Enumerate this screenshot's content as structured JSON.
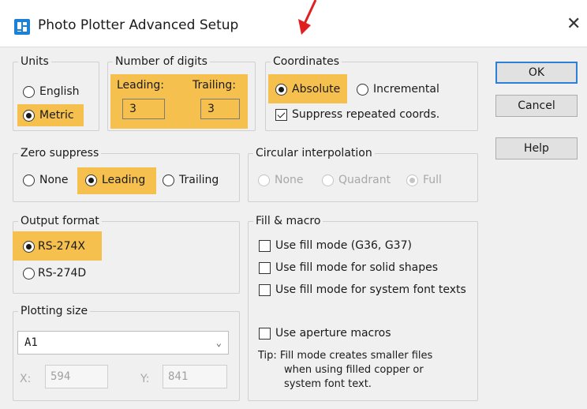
{
  "window": {
    "title": "Photo Plotter Advanced Setup",
    "close_symbol": "✕"
  },
  "colors": {
    "highlight": "#f5c04e",
    "accent_blue": "#1e7fd6",
    "annotation_arrow": "#e02020"
  },
  "units": {
    "legend": "Units",
    "options": [
      "English",
      "Metric"
    ],
    "selected": "Metric"
  },
  "digits": {
    "legend": "Number of digits",
    "leading_label": "Leading:",
    "trailing_label": "Trailing:",
    "leading_value": "3",
    "trailing_value": "3"
  },
  "coordinates": {
    "legend": "Coordinates",
    "options": [
      "Absolute",
      "Incremental"
    ],
    "selected": "Absolute",
    "suppress_label": "Suppress repeated coords.",
    "suppress_checked": true
  },
  "zero_suppress": {
    "legend": "Zero suppress",
    "options": [
      "None",
      "Leading",
      "Trailing"
    ],
    "selected": "Leading"
  },
  "circular": {
    "legend": "Circular interpolation",
    "options": [
      "None",
      "Quadrant",
      "Full"
    ],
    "selected": "Full",
    "enabled": false
  },
  "output_format": {
    "legend": "Output format",
    "options": [
      "RS-274X",
      "RS-274D"
    ],
    "selected": "RS-274X"
  },
  "fill_macro": {
    "legend": "Fill & macro",
    "checkboxes": [
      "Use fill mode (G36, G37)",
      "Use fill mode for solid shapes",
      "Use fill mode for system font texts",
      "Use aperture macros"
    ],
    "tip_lines": [
      "Tip: Fill mode creates smaller files",
      "when using filled copper or",
      "system font text."
    ]
  },
  "plotting_size": {
    "legend": "Plotting size",
    "selected": "A1",
    "x_label": "X:",
    "x_value": "594",
    "y_label": "Y:",
    "y_value": "841"
  },
  "buttons": {
    "ok": "OK",
    "cancel": "Cancel",
    "help": "Help"
  }
}
